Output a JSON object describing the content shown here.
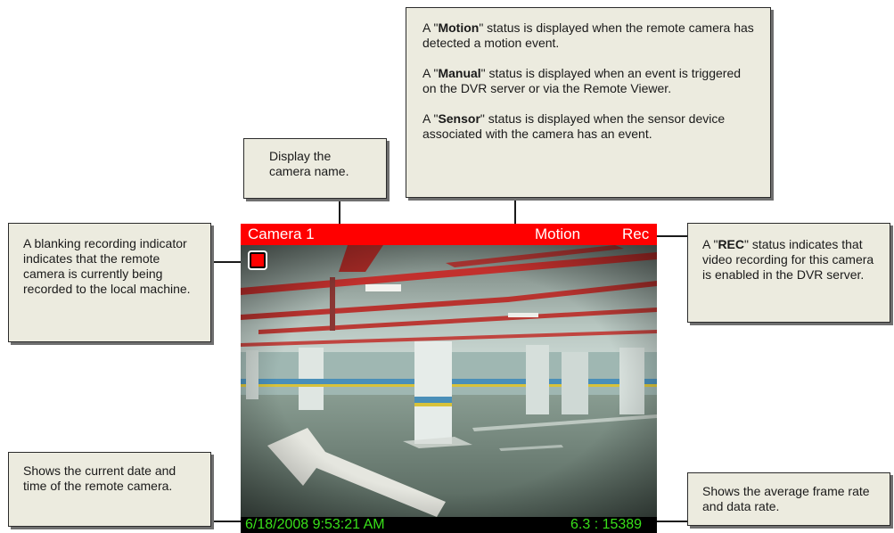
{
  "camera": {
    "name": "Camera 1",
    "status": "Motion",
    "rec": "Rec",
    "datetime": "6/18/2008 9:53:21 AM",
    "rates": "6.3 : 15389"
  },
  "callouts": {
    "camera_name": "Display the camera name.",
    "status": {
      "motion_pre": "A \"",
      "motion_bold": "Motion",
      "motion_post": "\" status is displayed when the remote camera has detected a motion event.",
      "manual_pre": "A \"",
      "manual_bold": "Manual",
      "manual_post": "\" status is displayed when an event is triggered on the DVR server or via the Remote Viewer.",
      "sensor_pre": "A \"",
      "sensor_bold": "Sensor",
      "sensor_post": "\" status is displayed when the sensor device associated with the camera has an event."
    },
    "recording_indicator": "A blanking recording indicator indicates that the remote camera is currently being recorded to the local machine.",
    "rec": {
      "pre": "A \"",
      "bold": "REC",
      "post": "\" status indicates that video recording for this camera is enabled in the DVR server."
    },
    "datetime": "Shows the current date and time of  the remote camera.",
    "rates": "Shows the average frame rate and data rate."
  },
  "colors": {
    "title_bar": "#ff0000",
    "overlay_text": "#39e01a",
    "callout_bg": "#ecebdf"
  }
}
